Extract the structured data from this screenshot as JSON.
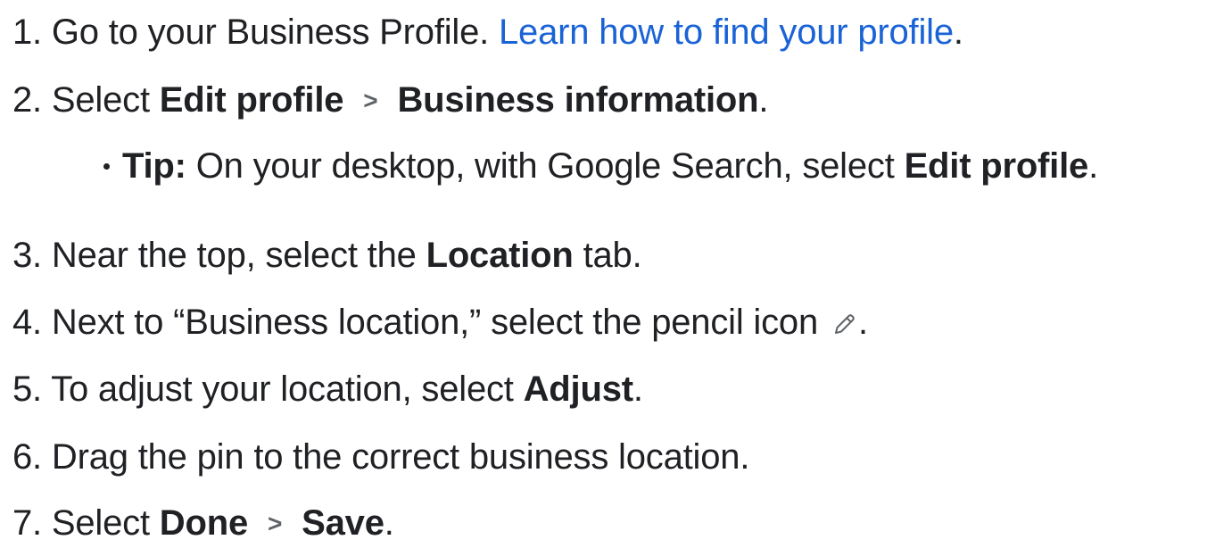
{
  "steps": [
    {
      "num": "1.",
      "text": "Go to your Business Profile.",
      "link": "Learn how to find your profile",
      "end": "."
    },
    {
      "num": "2.",
      "pre": "Select",
      "b1": "Edit profile",
      "chevron": ">",
      "b2": "Business information",
      "end": "."
    },
    {
      "num": "3.",
      "pre": "Near the top, select the",
      "b1": "Location",
      "post": "tab."
    },
    {
      "num": "4.",
      "pre": "Next to “Business location,” select the pencil icon",
      "end": "."
    },
    {
      "num": "5.",
      "pre": "To adjust your location, select",
      "b1": "Adjust",
      "end": "."
    },
    {
      "num": "6.",
      "pre": "Drag the pin to the correct business location."
    },
    {
      "num": "7.",
      "pre": "Select",
      "b1": "Done",
      "chevron": ">",
      "b2": "Save",
      "end": "."
    }
  ],
  "tip": {
    "label": "Tip:",
    "pre": "On your desktop, with Google Search, select",
    "b1": "Edit profile",
    "end": "."
  },
  "icons": {
    "pencil": "pencil-icon"
  },
  "colors": {
    "link": "#1a63d6",
    "text": "#202124"
  }
}
